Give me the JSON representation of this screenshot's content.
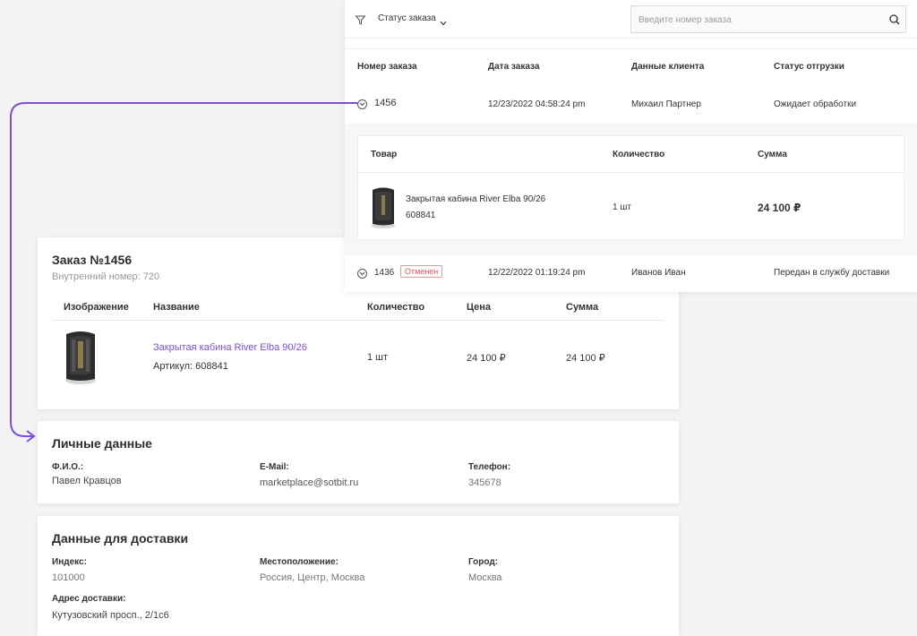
{
  "colors": {
    "accent": "#7b4fd6",
    "cancel": "#e05353",
    "background": "#f3f3f4"
  },
  "orders_list": {
    "filter": {
      "label": "Статус заказа"
    },
    "search": {
      "placeholder": "Введите номер заказа"
    },
    "columns": [
      "Номер заказа",
      "Дата заказа",
      "Данные клиента",
      "Статус отгрузки"
    ],
    "rows": [
      {
        "number": "1456",
        "date": "12/23/2022 04:58:24 pm",
        "client": "Михаил Партнер",
        "status": "Ожидает обработки",
        "badge": ""
      },
      {
        "number": "1436",
        "date": "12/22/2022 01:19:24 pm",
        "client": "Иванов Иван",
        "status": "Передан в службу доставки",
        "badge": "Отменен"
      }
    ],
    "expanded": {
      "columns": [
        "Товар",
        "Количество",
        "Сумма"
      ],
      "item": {
        "name": "Закрытая кабина River Elba 90/26",
        "article": "608841",
        "qty": "1 шт",
        "sum": "24 100 ₽"
      }
    }
  },
  "order_detail": {
    "title": "Заказ №1456",
    "internal": "Внутренний номер: 720",
    "columns": [
      "Изображение",
      "Название",
      "Количество",
      "Цена",
      "Сумма"
    ],
    "item": {
      "name": "Закрытая кабина River Elba 90/26",
      "article": "Артикул: 608841",
      "qty": "1 шт",
      "price": "24 100 ₽",
      "sum": "24 100 ₽"
    }
  },
  "personal": {
    "title": "Личные данные",
    "fio_label": "Ф.И.О.:",
    "fio": "Павел Кравцов",
    "email_label": "E-Mail:",
    "email": "marketplace@sotbit.ru",
    "phone_label": "Телефон:",
    "phone": "345678"
  },
  "delivery": {
    "title": "Данные для доставки",
    "index_label": "Индекс:",
    "index": "101000",
    "location_label": "Местоположение:",
    "location": "Россия, Центр, Москва",
    "city_label": "Город:",
    "city": "Москва",
    "address_label": "Адрес доставки:",
    "address": "Кутузовский просп., 2/1с6"
  }
}
